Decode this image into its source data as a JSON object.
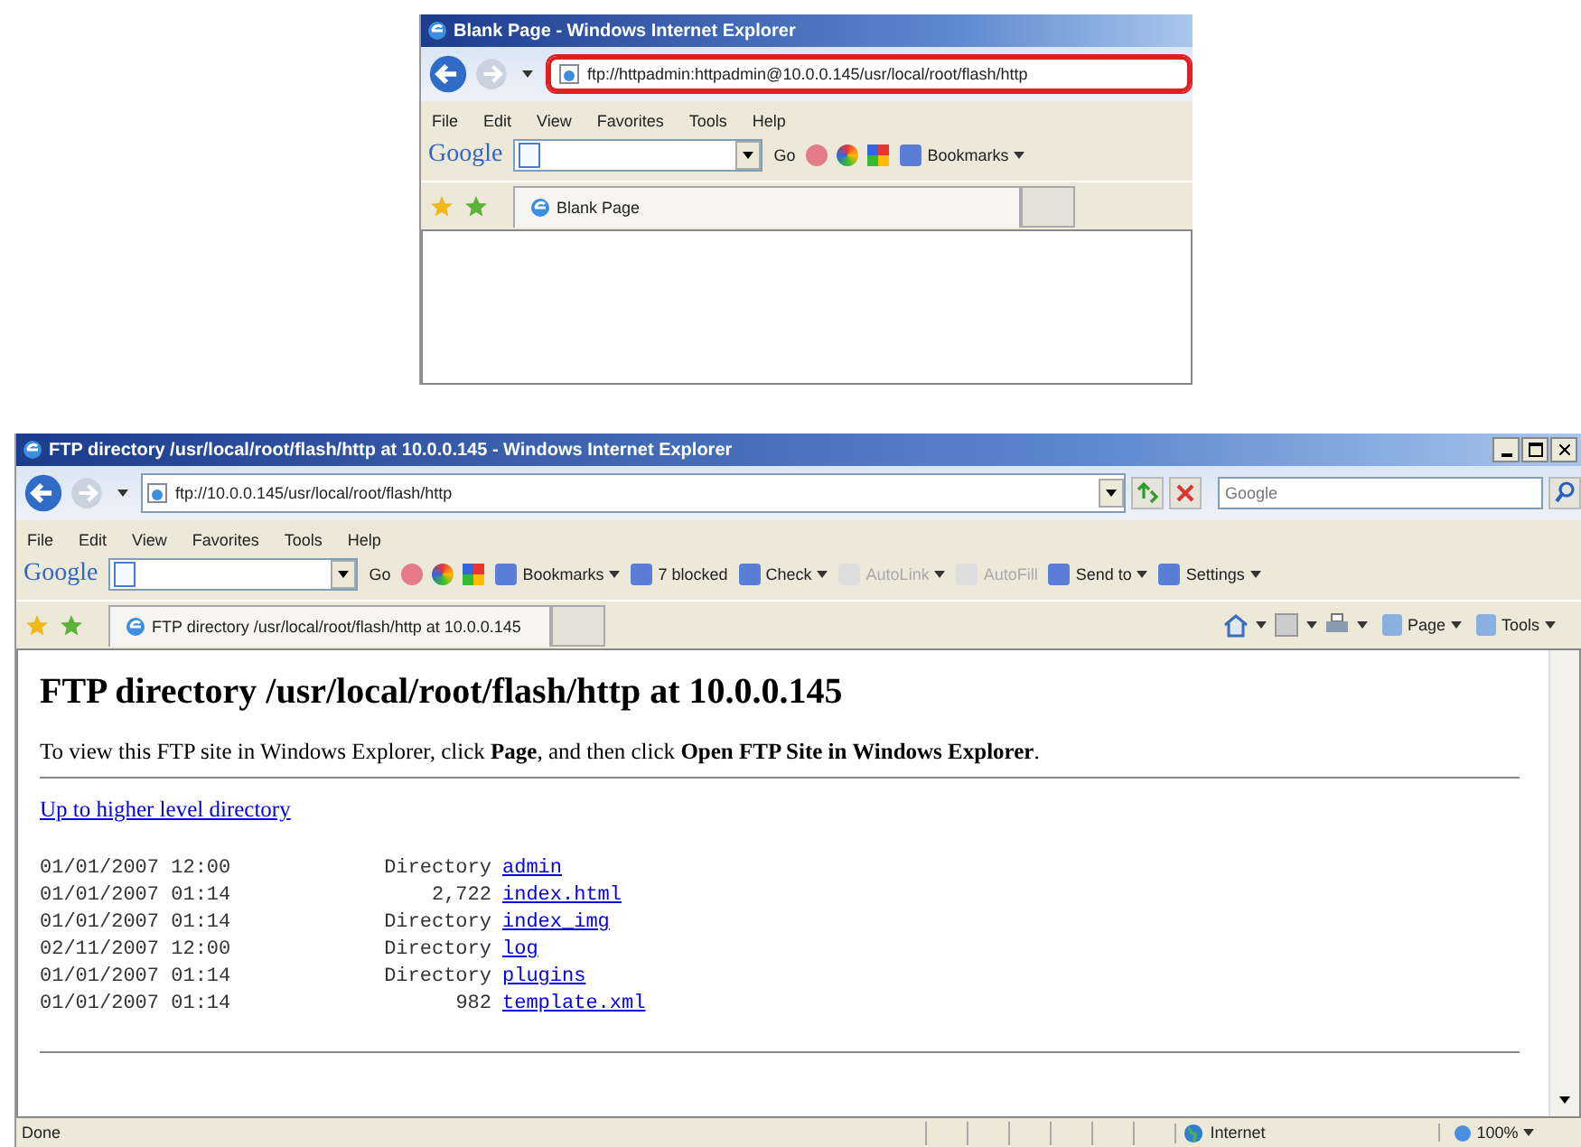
{
  "windows": [
    {
      "title": "Blank Page - Windows Internet Explorer",
      "address": "ftp://httpadmin:httpadmin@10.0.0.145/usr/local/root/flash/http",
      "address_highlighted": true,
      "menu": [
        "File",
        "Edit",
        "View",
        "Favorites",
        "Tools",
        "Help"
      ],
      "google_logo": "Google",
      "google_toolbar": [
        {
          "label": "Go",
          "kind": "plain",
          "disabled": false,
          "dropdown": false
        },
        {
          "label": "Bookmarks",
          "kind": "icon",
          "disabled": false,
          "dropdown": true
        }
      ],
      "tab": "Blank Page"
    },
    {
      "title": "FTP directory /usr/local/root/flash/http at 10.0.0.145 - Windows Internet Explorer",
      "address": "ftp://10.0.0.145/usr/local/root/flash/http",
      "address_highlighted": false,
      "search": {
        "placeholder": "Google"
      },
      "menu": [
        "File",
        "Edit",
        "View",
        "Favorites",
        "Tools",
        "Help"
      ],
      "google_logo": "Google",
      "google_toolbar": [
        {
          "label": "Go",
          "kind": "plain",
          "disabled": false,
          "dropdown": false
        },
        {
          "label": "Bookmarks",
          "kind": "icon",
          "disabled": false,
          "dropdown": true
        },
        {
          "label": "7 blocked",
          "kind": "icon",
          "disabled": false,
          "dropdown": false
        },
        {
          "label": "Check",
          "kind": "icon",
          "disabled": false,
          "dropdown": true
        },
        {
          "label": "AutoLink",
          "kind": "icon",
          "disabled": true,
          "dropdown": true
        },
        {
          "label": "AutoFill",
          "kind": "icon",
          "disabled": true,
          "dropdown": false
        },
        {
          "label": "Send to",
          "kind": "icon",
          "disabled": false,
          "dropdown": true
        },
        {
          "label": "Settings",
          "kind": "icon",
          "disabled": false,
          "dropdown": true
        }
      ],
      "tab": "FTP directory /usr/local/root/flash/http at 10.0.0.145",
      "command_bar": [
        "Page",
        "Tools"
      ],
      "page": {
        "heading": "FTP directory /usr/local/root/flash/http at 10.0.0.145",
        "intro": "To view this FTP site in Windows Explorer, click **Page**, and then click **Open FTP Site in Windows Explorer**.",
        "up_link": "Up to higher level directory",
        "listing": [
          {
            "date": "01/01/2007 12:00",
            "size": "Directory",
            "name": "admin"
          },
          {
            "date": "01/01/2007 01:14",
            "size": "2,722",
            "name": "index.html"
          },
          {
            "date": "01/01/2007 01:14",
            "size": "Directory",
            "name": "index_img"
          },
          {
            "date": "02/11/2007 12:00",
            "size": "Directory",
            "name": "log"
          },
          {
            "date": "01/01/2007 01:14",
            "size": "Directory",
            "name": "plugins"
          },
          {
            "date": "01/01/2007 01:14",
            "size": "982",
            "name": "template.xml"
          }
        ]
      },
      "status_bar": {
        "text": "Done",
        "zone": "Internet",
        "zoom": "100%"
      }
    }
  ]
}
